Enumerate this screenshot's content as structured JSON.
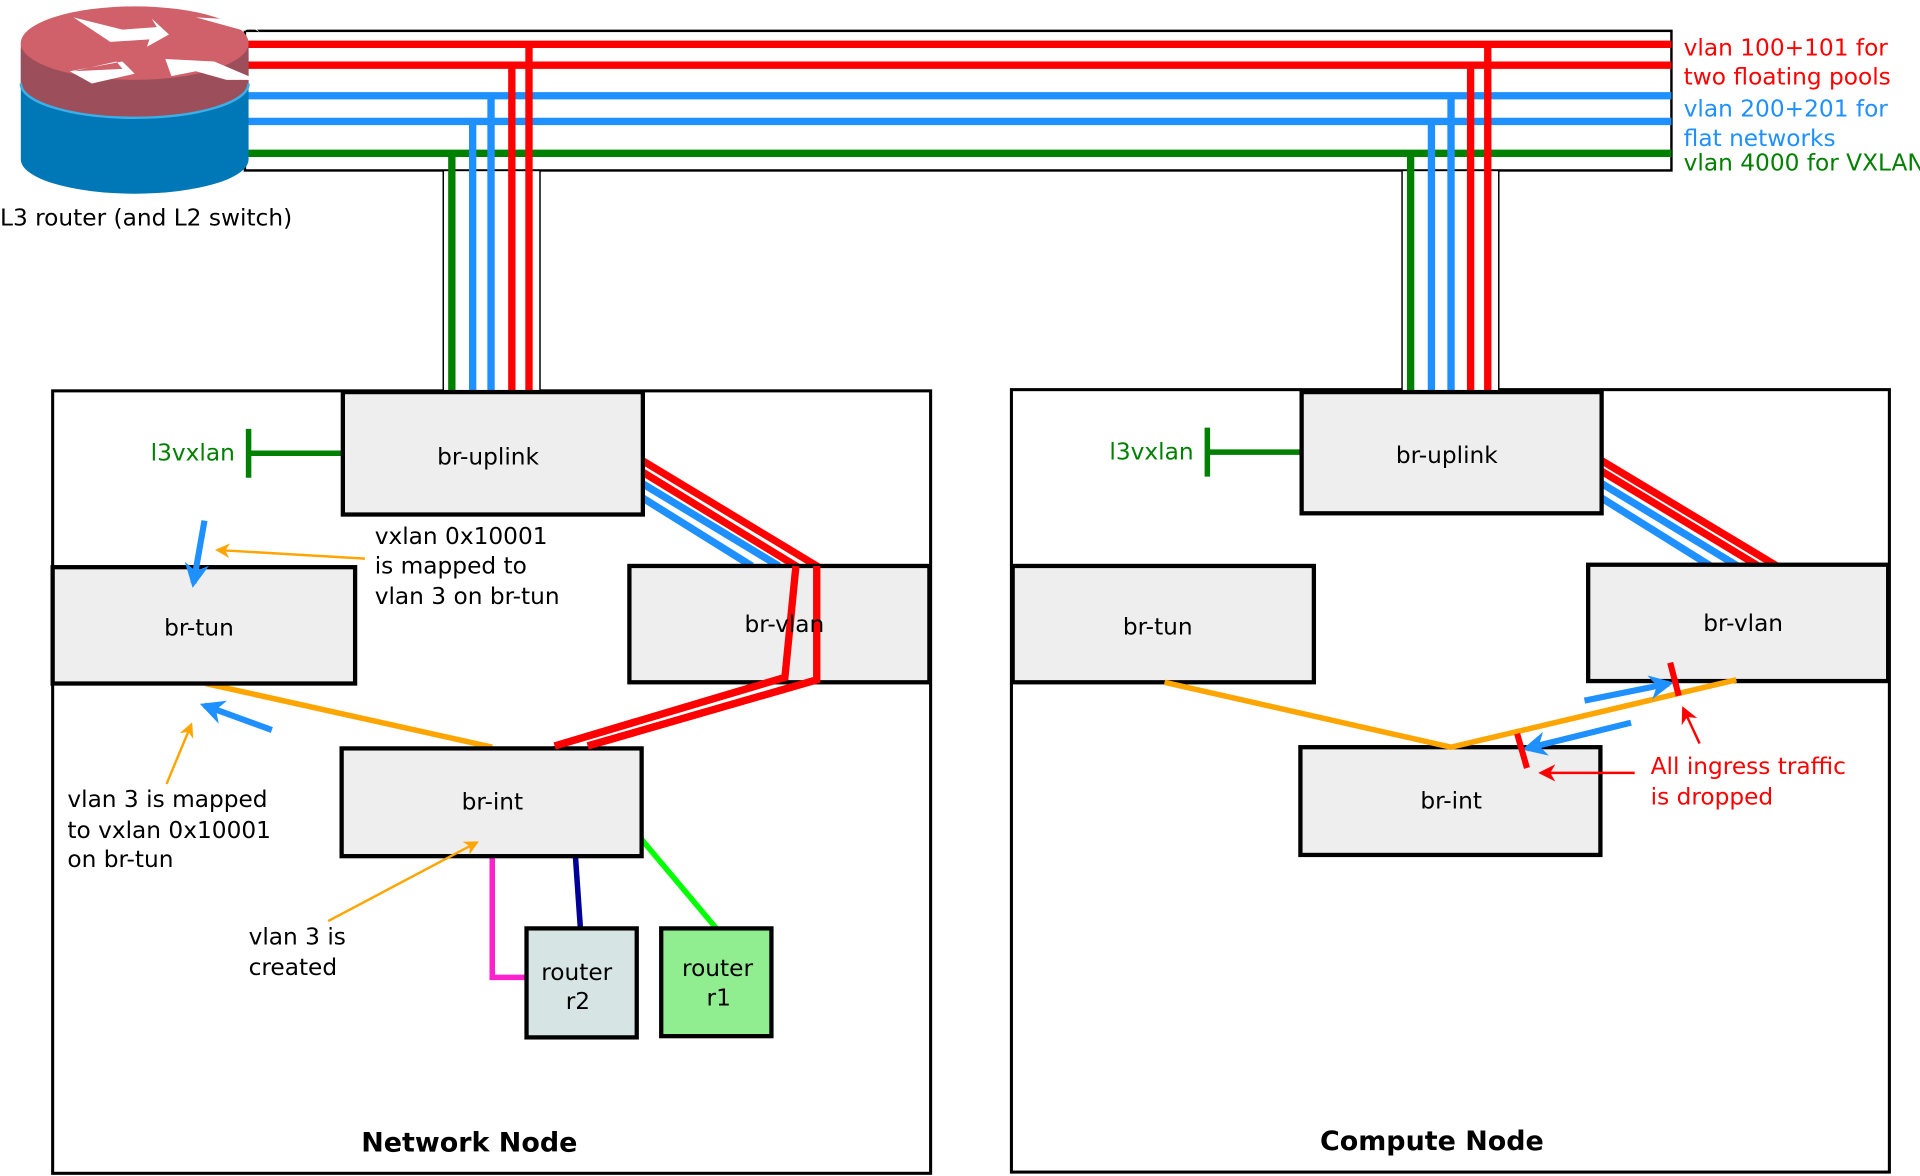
{
  "router": {
    "label": "L3 router (and L2 switch)",
    "icon": "router-icon"
  },
  "trunk": {
    "legend": [
      {
        "lines": [
          "vlan 100+101 for",
          "two floating pools"
        ],
        "color": "#ff0000"
      },
      {
        "lines": [
          "vlan 200+201 for",
          "flat networks"
        ],
        "color": "#1e90ff"
      },
      {
        "lines": [
          "vlan 4000 for VXLAN"
        ],
        "color": "#008000"
      }
    ]
  },
  "colors": {
    "red": "#ff0000",
    "blue": "#1e90ff",
    "green": "#008000",
    "orange": "#ffa500",
    "magenta": "#ff22cc",
    "navy": "#000099",
    "lime": "#00ff00",
    "bridge_fill": "#eeeeee",
    "r2_fill": "#d7e4e4",
    "r1_fill": "#90ee90"
  },
  "network_node": {
    "title": "Network Node",
    "l3vxlan": "l3vxlan",
    "bridges": {
      "uplink": "br-uplink",
      "tun": "br-tun",
      "vlan": "br-vlan",
      "int": "br-int"
    },
    "routers": [
      {
        "line1": "router",
        "line2": "r2"
      },
      {
        "line1": "router",
        "line2": "r1"
      }
    ],
    "notes": {
      "vxlan_map": [
        "vxlan 0x10001",
        "is mapped to",
        "vlan 3 on br-tun"
      ],
      "vlan_map": [
        "vlan 3 is mapped",
        "to vxlan 0x10001",
        "on br-tun"
      ],
      "vlan_created": [
        "vlan 3 is",
        "created"
      ]
    }
  },
  "compute_node": {
    "title": "Compute Node",
    "l3vxlan": "l3vxlan",
    "bridges": {
      "uplink": "br-uplink",
      "tun": "br-tun",
      "vlan": "br-vlan",
      "int": "br-int"
    },
    "notes": {
      "dropped": [
        "All ingress traffic",
        "is dropped"
      ]
    }
  }
}
